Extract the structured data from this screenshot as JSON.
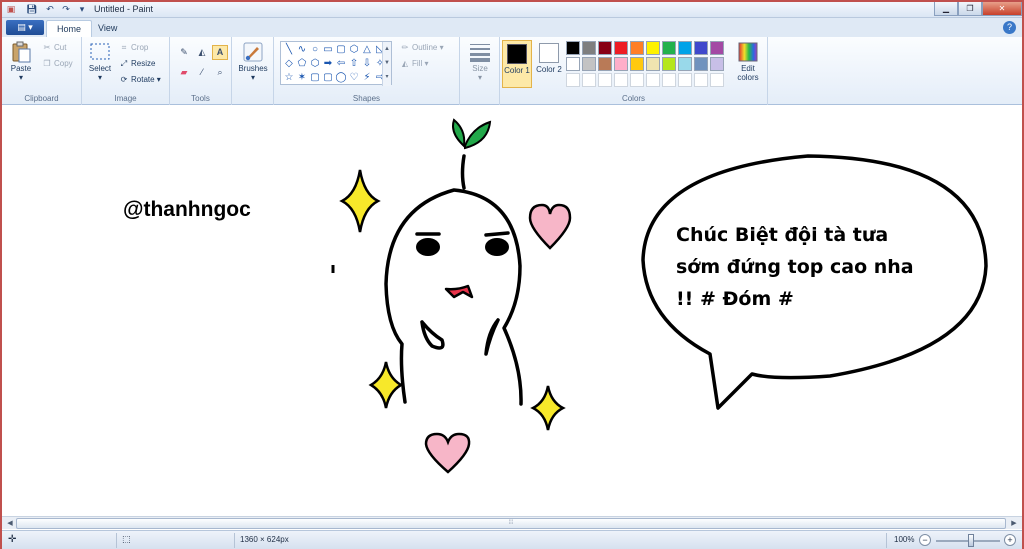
{
  "window": {
    "title": "Untitled - Paint",
    "quick_access": [
      "paint-icon",
      "save-icon",
      "undo-icon",
      "redo-icon",
      "customize-icon"
    ],
    "controls": {
      "minimize": "▁",
      "maximize": "❐",
      "close": "✕"
    }
  },
  "tabs": {
    "app_menu": "▤ ▾",
    "home": "Home",
    "view": "View",
    "help": "?"
  },
  "ribbon": {
    "clipboard": {
      "label": "Clipboard",
      "paste": "Paste",
      "cut": "Cut",
      "copy": "Copy"
    },
    "image": {
      "label": "Image",
      "select": "Select",
      "crop": "Crop",
      "resize": "Resize",
      "rotate": "Rotate ▾"
    },
    "tools": {
      "label": "Tools",
      "items": [
        "pencil-icon",
        "fill-icon",
        "text-icon",
        "eraser-icon",
        "color-picker-icon",
        "magnifier-icon"
      ],
      "text_glyph": "A"
    },
    "brushes": {
      "label": "Brushes"
    },
    "shapes": {
      "label": "Shapes",
      "outline": "Outline ▾",
      "fill": "Fill ▾",
      "glyphs": [
        "╲",
        "∿",
        "○",
        "▭",
        "▢",
        "⬡",
        "△",
        "◺",
        "◇",
        "⬠",
        "⬡",
        "➡",
        "⇦",
        "⇧",
        "⇩",
        "✧",
        "☆",
        "✶",
        "▢",
        "▢",
        "◯",
        "♡",
        "⚡",
        "⇨"
      ]
    },
    "size": {
      "label": "Size"
    },
    "colors": {
      "label": "Colors",
      "color1_label": "Color 1",
      "color2_label": "Color 2",
      "color1": "#000000",
      "color2": "#ffffff",
      "edit_label": "Edit colors",
      "palette_row1": [
        "#000000",
        "#7f7f7f",
        "#880015",
        "#ed1c24",
        "#ff7f27",
        "#fff200",
        "#22b14c",
        "#00a2e8",
        "#3f48cc",
        "#a349a4"
      ],
      "palette_row2": [
        "#ffffff",
        "#c3c3c3",
        "#b97a57",
        "#ffaec9",
        "#ffc90e",
        "#efe4b0",
        "#b5e61d",
        "#99d9ea",
        "#7092be",
        "#c8bfe7"
      ]
    }
  },
  "canvas": {
    "handle_text": "@thanhngoc",
    "bubble_lines": [
      "Chúc Biệt đội tà tưa",
      "sớm đứng top cao nha",
      "!! # Đóm #"
    ],
    "colors": {
      "leaf": "#22a84a",
      "heart": "#f7b6c8",
      "star": "#f7e82a",
      "mouth": "#e8334a"
    }
  },
  "status": {
    "cursor_icon": "✛",
    "selection_icon": "⬚",
    "canvas_size": "1360 × 624px",
    "zoom": "100%",
    "zoom_level": 1.0,
    "zoom_out": "−",
    "zoom_in": "+"
  }
}
